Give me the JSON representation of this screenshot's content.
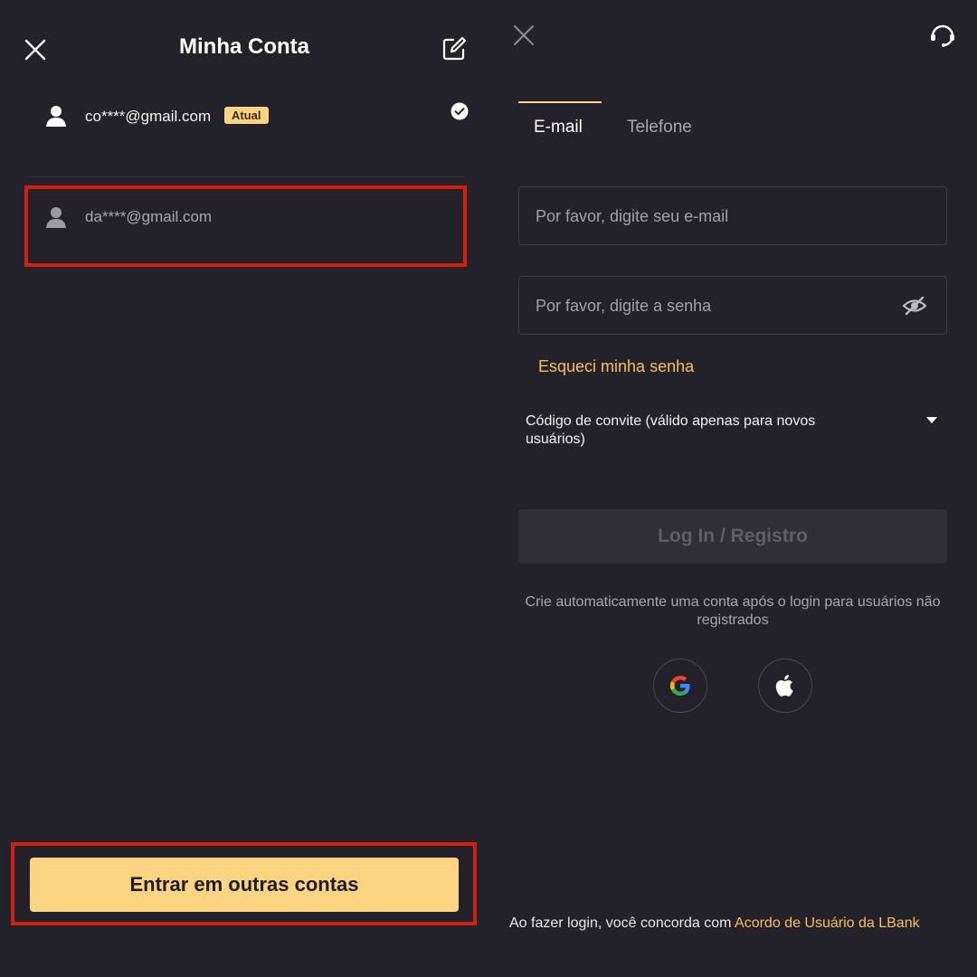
{
  "left_panel": {
    "title": "Minha Conta",
    "accounts": [
      {
        "email": "co****@gmail.com",
        "badge": "Atual",
        "selected": true
      },
      {
        "email": "da****@gmail.com",
        "badge": "",
        "selected": false
      }
    ],
    "switch_button_label": "Entrar em outras contas",
    "icons": {
      "close": "close-icon",
      "edit": "edit-icon",
      "avatar": "user-icon",
      "check": "check-circle-icon"
    }
  },
  "right_panel": {
    "tabs": [
      {
        "label": "E-mail",
        "active": true
      },
      {
        "label": "Telefone",
        "active": false
      }
    ],
    "email_placeholder": "Por favor, digite seu e-mail",
    "password_placeholder": "Por favor, digite a senha",
    "forgot_password": "Esqueci minha senha",
    "invite_code_label": "Código de convite (válido apenas para novos usuários)",
    "login_button": "Log In / Registro",
    "auto_account_note": "Crie automaticamente uma conta após o login para usuários não registrados",
    "social": [
      "google-icon",
      "apple-icon"
    ],
    "terms_prefix": "Ao fazer login, você concorda com",
    "terms_link": "Acordo de Usuário da LBank",
    "icons": {
      "close": "close-icon",
      "support": "headset-icon",
      "visibility": "eye-off-icon",
      "dropdown": "caret-down-icon"
    }
  },
  "colors": {
    "background": "#23212a",
    "accent": "#fdd582",
    "link": "#f7c15a",
    "highlight": "#d41f0d"
  }
}
